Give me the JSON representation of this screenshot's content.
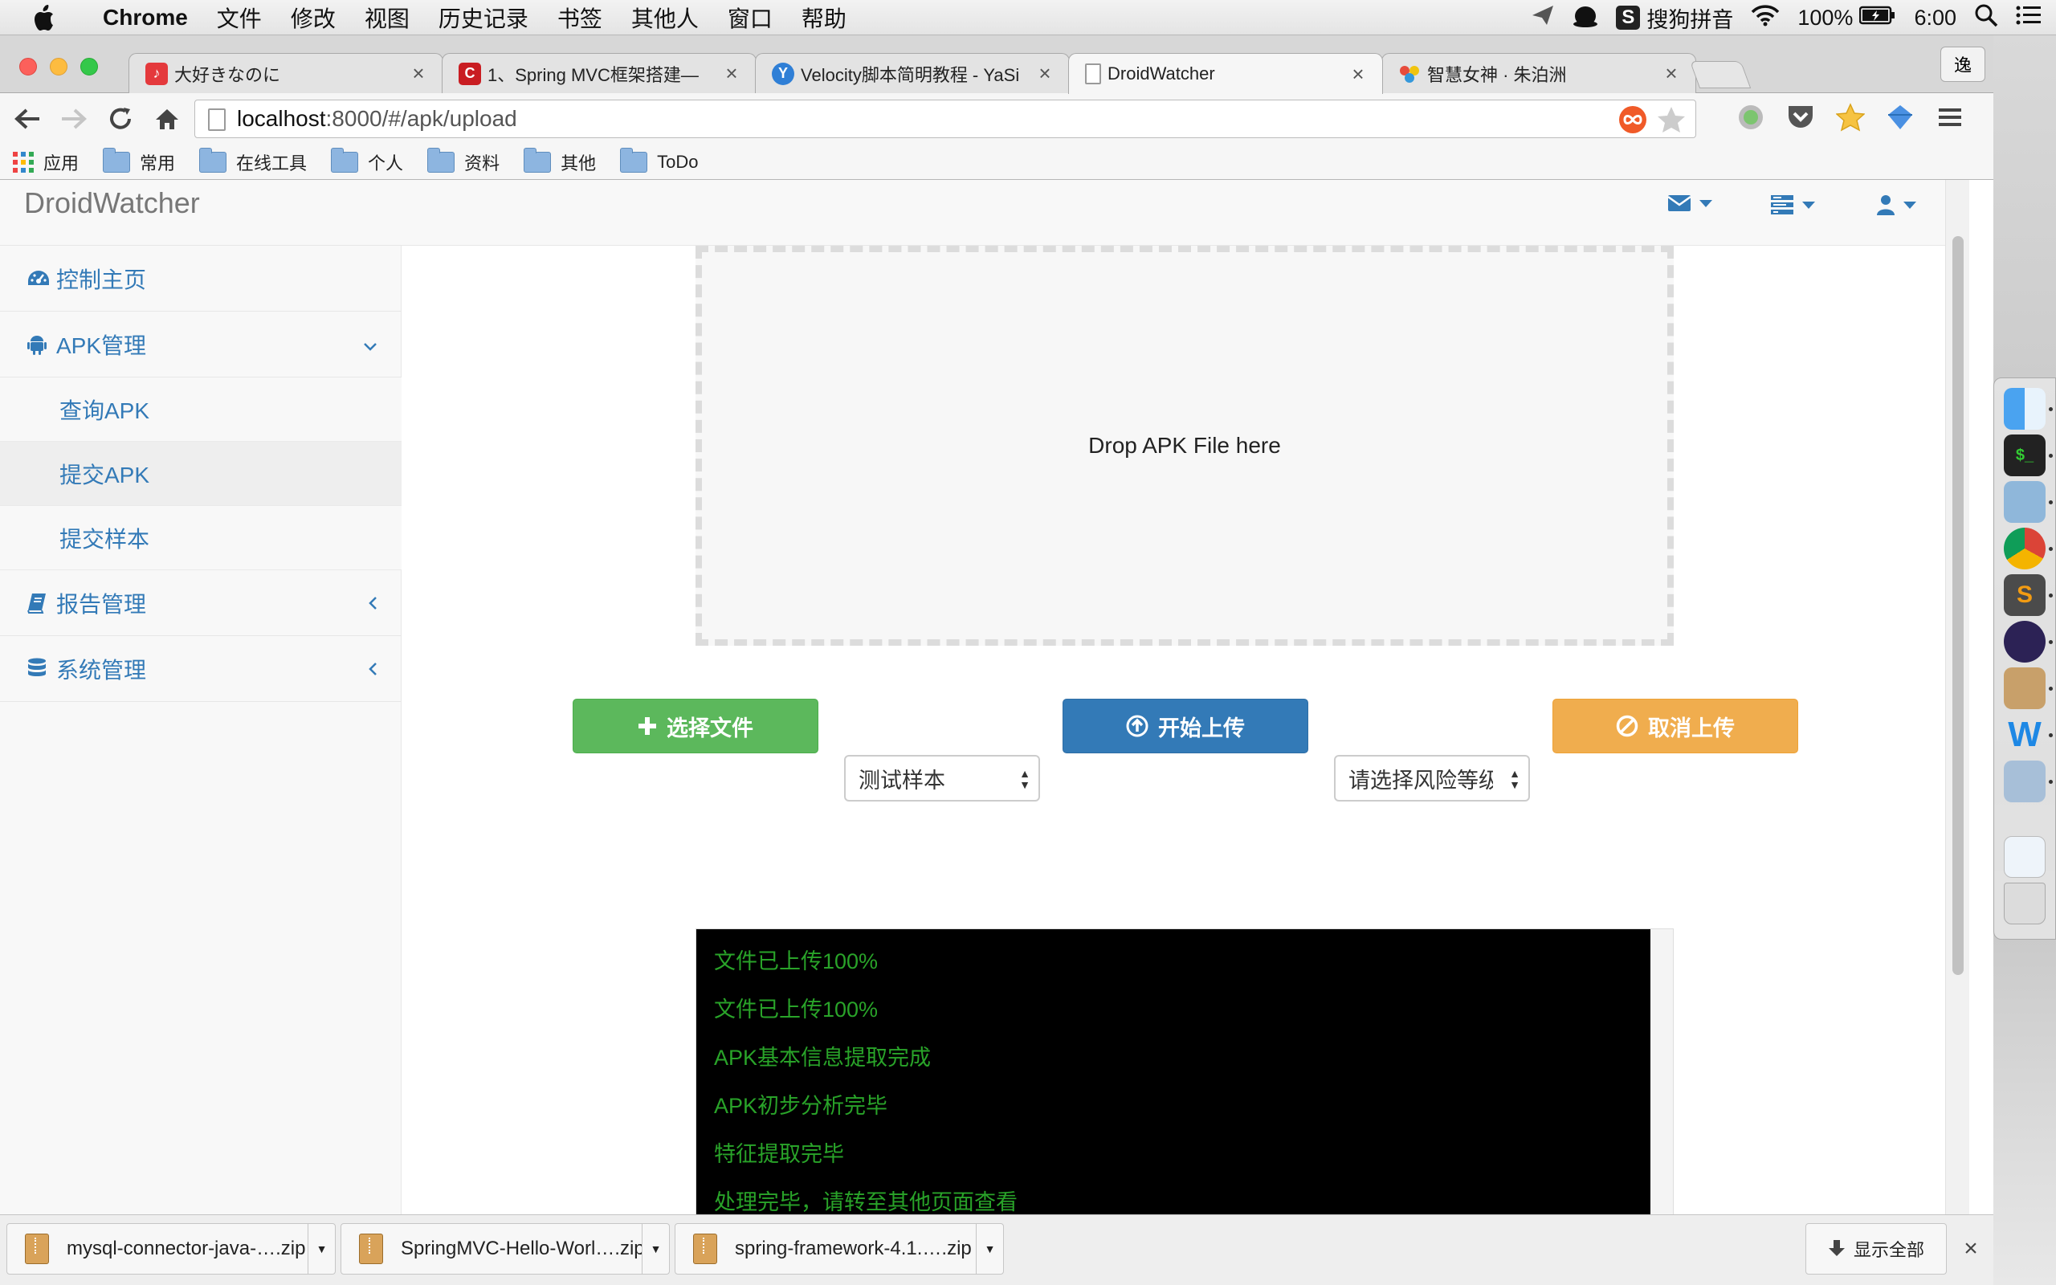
{
  "menubar": {
    "app_name": "Chrome",
    "items": [
      "文件",
      "修改",
      "视图",
      "历史记录",
      "书签",
      "其他人",
      "窗口",
      "帮助"
    ],
    "input_method": "搜狗拼音",
    "battery": "100%",
    "clock": "6:00"
  },
  "browser": {
    "tabs": [
      {
        "title": "大好きなのに",
        "favicon": "netease-music-icon",
        "color": "#e4393c",
        "glyph": "♪"
      },
      {
        "title": "1、Spring MVC框架搭建—",
        "favicon": "csdn-icon",
        "color": "#c91d22",
        "glyph": "C"
      },
      {
        "title": "Velocity脚本简明教程 - YaSi",
        "favicon": "site-icon",
        "color": "#2f7fd6",
        "glyph": "Y"
      },
      {
        "title": "DroidWatcher",
        "favicon": "page-icon",
        "color": "#ffffff",
        "glyph": ""
      },
      {
        "title": "智慧女神 · 朱泊洲",
        "favicon": "color-dots-icon",
        "color": "#ffffff",
        "glyph": ""
      }
    ],
    "profile_label": "逸",
    "url_host": "localhost",
    "url_rest": ":8000/#/apk/upload",
    "bookmarks": {
      "apps_label": "应用",
      "folders": [
        "常用",
        "在线工具",
        "个人",
        "资料",
        "其他",
        "ToDo"
      ]
    }
  },
  "app": {
    "brand": "DroidWatcher",
    "sidebar": {
      "items": [
        {
          "label": "控制主页",
          "icon": "dashboard-icon"
        },
        {
          "label": "APK管理",
          "icon": "android-icon"
        },
        {
          "label": "报告管理",
          "icon": "book-icon"
        },
        {
          "label": "系统管理",
          "icon": "database-icon"
        }
      ],
      "sub_items": [
        "查询APK",
        "提交APK",
        "提交样本"
      ]
    },
    "dropzone_text": "Drop APK File here",
    "buttons": {
      "choose": "选择文件",
      "upload": "开始上传",
      "cancel": "取消上传"
    },
    "selects": {
      "sample_type": "测试样本",
      "risk_level": "请选择风险等级"
    },
    "console_lines": [
      "文件已上传100%",
      "文件已上传100%",
      "APK基本信息提取完成",
      "APK初步分析完毕",
      "特征提取完毕",
      "处理完毕，请转至其他页面查看"
    ]
  },
  "downloads": {
    "items": [
      "mysql-connector-java-….zip",
      "SpringMVC-Hello-Worl….zip",
      "spring-framework-4.1.….zip"
    ],
    "show_all": "显示全部"
  },
  "colors": {
    "link": "#337ab7",
    "success": "#5cb85c",
    "primary": "#337ab7",
    "warning": "#f0ad4e",
    "console_text": "#29a329"
  }
}
